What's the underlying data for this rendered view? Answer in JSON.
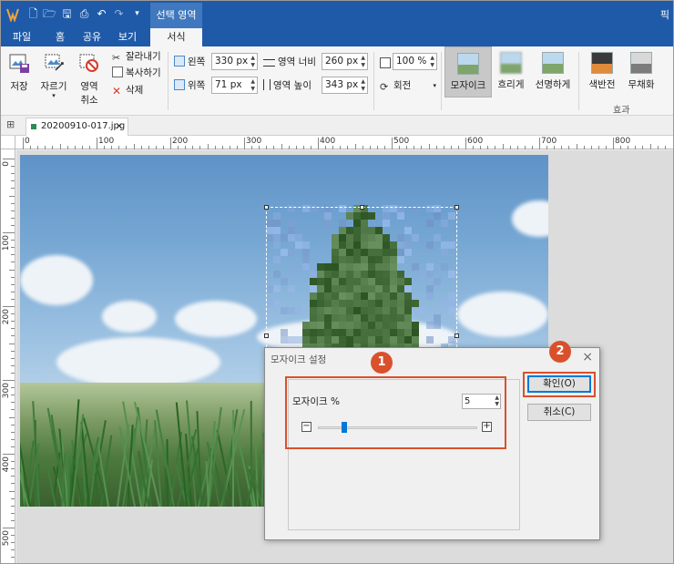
{
  "window": {
    "title_partial": "픽",
    "context_tab": "선택 영역"
  },
  "menu_tabs": [
    "파일",
    "홈",
    "공유",
    "보기",
    "서식"
  ],
  "active_tab_index": 4,
  "ribbon": {
    "save": "저장",
    "crop": "자르기",
    "deselect_line1": "영역",
    "deselect_line2": "취소",
    "cut": "잘라내기",
    "copy": "복사하기",
    "delete": "삭제",
    "left_label": "왼쪽",
    "left_value": "330 px",
    "top_label": "위쪽",
    "top_value": "71 px",
    "width_label": "영역 너비",
    "width_value": "260 px",
    "height_label": "영역 높이",
    "height_value": "343 px",
    "zoom_value": "100 %",
    "rotate": "회전",
    "effects": [
      "모자이크",
      "흐리게",
      "선명하게",
      "색반전",
      "무채화"
    ],
    "selected_effect_index": 0,
    "effects_group_label": "효과"
  },
  "document_tab": {
    "filename": "20200910-017.jpg",
    "close": "×"
  },
  "rulers": {
    "h_labels": [
      "0",
      "100",
      "200",
      "300",
      "400",
      "500",
      "600",
      "700",
      "800"
    ],
    "v_labels": [
      "0",
      "100",
      "200",
      "300",
      "400",
      "500"
    ]
  },
  "dialog": {
    "title": "모자이크 설정",
    "close": "×",
    "label": "모자이크 %",
    "value": "5",
    "slider_level": 0.05,
    "minus": "−",
    "plus": "+",
    "ok": "확인(O)",
    "cancel": "취소(C)"
  },
  "callouts": {
    "badge1": "1",
    "badge2": "2",
    "color": "#d9512c"
  },
  "colors": {
    "titlebar": "#1e5aa8",
    "accent": "#0078d7"
  }
}
